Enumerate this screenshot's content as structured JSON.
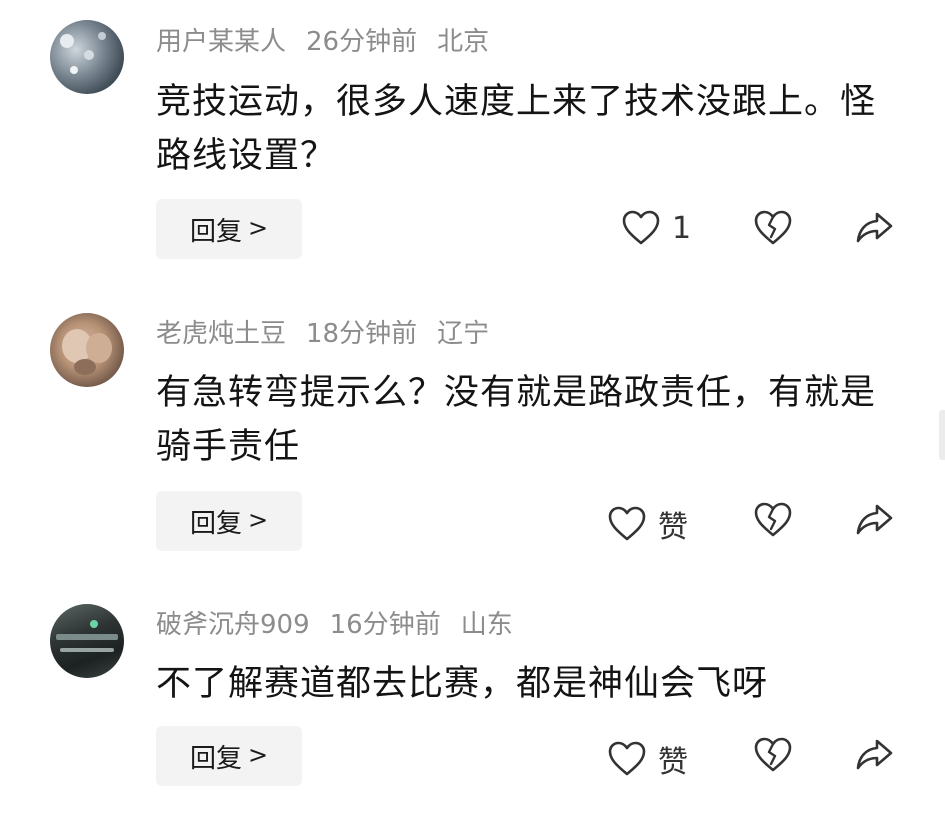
{
  "comments": [
    {
      "username": "用户某某人",
      "time": "26分钟前",
      "location": "北京",
      "text": "竞技运动，很多人速度上来了技术没跟上。怪路线设置？",
      "reply_label": "回复",
      "reply_chevron": ">",
      "like_label": "1",
      "avatar_icon": "avatar-image"
    },
    {
      "username": "老虎炖土豆",
      "time": "18分钟前",
      "location": "辽宁",
      "text": "有急转弯提示么？没有就是路政责任，有就是骑手责任",
      "reply_label": "回复",
      "reply_chevron": ">",
      "like_label": "赞",
      "avatar_icon": "avatar-image"
    },
    {
      "username": "破斧沉舟909",
      "time": "16分钟前",
      "location": "山东",
      "text": "不了解赛道都去比赛，都是神仙会飞呀",
      "reply_label": "回复",
      "reply_chevron": ">",
      "like_label": "赞",
      "avatar_icon": "avatar-image"
    }
  ],
  "icons": {
    "like": "heart-outline-icon",
    "dislike": "broken-heart-icon",
    "share": "share-arrow-icon"
  },
  "colors": {
    "meta_text": "#8c8c8c",
    "body_text": "#141414",
    "reply_bg": "#f3f3f3",
    "icon_stroke": "#333333"
  }
}
